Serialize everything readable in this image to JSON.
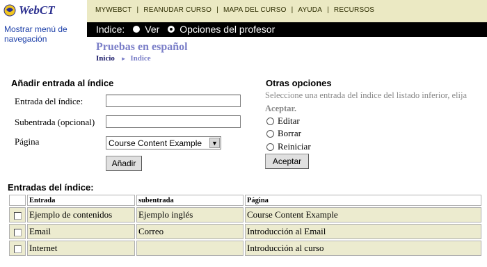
{
  "app": {
    "brand": "WebCT",
    "logo_icon": "webct-logo-icon"
  },
  "nav_toggle": "Mostrar menú de navegación",
  "top_menu": [
    "MYWEBCT",
    "REANUDAR CURSO",
    "MAPA DEL CURSO",
    "AYUDA",
    "RECURSOS"
  ],
  "view_bar": {
    "label": "Indice:",
    "options": [
      {
        "label": "Ver",
        "selected": false
      },
      {
        "label": "Opciones del profesor",
        "selected": true
      }
    ]
  },
  "page": {
    "title": "Pruebas en español",
    "breadcrumb": {
      "home": "Inicio",
      "current": "Indice"
    }
  },
  "add_form": {
    "heading": "Añadir entrada al índice",
    "entry_label": "Entrada del índice:",
    "entry_value": "",
    "subentry_label": "Subentrada (opcional)",
    "subentry_value": "",
    "page_label": "Página",
    "page_selected": "Course Content Example",
    "add_button": "Añadir"
  },
  "other_options": {
    "heading": "Otras opciones",
    "description": "Seleccione una entrada del índice del listado inferior, elija",
    "accept_hint": "Aceptar.",
    "options": [
      "Editar",
      "Borrar",
      "Reiniciar"
    ],
    "accept_button": "Aceptar"
  },
  "entries": {
    "heading": "Entradas del índice:",
    "columns": [
      "Entrada",
      "subentrada",
      "Página"
    ],
    "rows": [
      {
        "entrada": "Ejemplo de contenidos",
        "subentrada": "Ejemplo inglés",
        "pagina": "Course Content Example"
      },
      {
        "entrada": "Email",
        "subentrada": "Correo",
        "pagina": "Introducción al Email"
      },
      {
        "entrada": "Internet",
        "subentrada": "",
        "pagina": "Introducción al curso"
      }
    ]
  },
  "colors": {
    "menu_bg": "#ebe9c3",
    "view_bar_bg": "#000000",
    "title": "#7b7fc8",
    "row_bg": "#ecebcf",
    "link": "#1b3ea8"
  }
}
